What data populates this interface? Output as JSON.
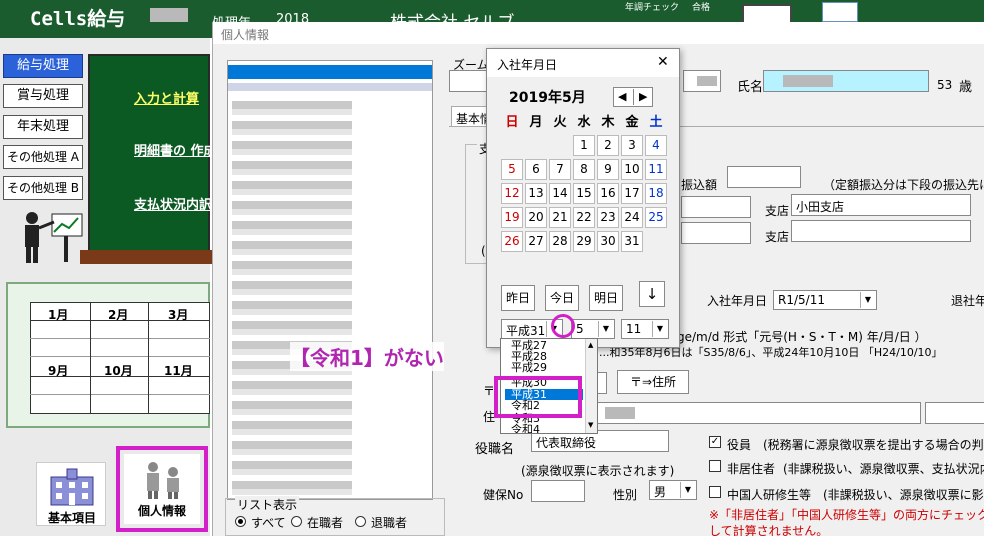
{
  "app": {
    "title": "Cells給与",
    "header_label": "処理年",
    "header_year": "2018",
    "company": "株式会社 セルブ",
    "top_right_1": "年調チェック",
    "top_right_2": "合格"
  },
  "left_menu": {
    "items": [
      "給与処理",
      "賞与処理",
      "年末処理",
      "その他処理 A",
      "その他処理 B"
    ]
  },
  "board": {
    "links": [
      "入力と計算",
      "明細書の 作成",
      "支払状況内訳"
    ]
  },
  "months": {
    "row1": [
      "1月",
      "2月",
      "3月"
    ],
    "row2": [
      "9月",
      "10月",
      "11月"
    ]
  },
  "bottom_icons": {
    "basic": "基本項目",
    "personal": "個人情報"
  },
  "window": {
    "title": "個人情報",
    "zoom_label": "ズーム",
    "tab_basic": "基本情",
    "name_label": "氏名",
    "age": "53",
    "age_unit": "歳",
    "fixed_amount_label": "振込額",
    "fixed_note": "（定額振込分は下段の振込先に",
    "branch_label": "支店",
    "branch_value": "小田支店",
    "branch_label2": "支店",
    "hire_date_label": "入社年月日",
    "hire_date_value": "R1/5/11",
    "retire_label": "退社年",
    "format_note": "ge/m/d  形式「元号(H・S・T・M)  年/月/日 ）",
    "example_note": "...和35年8月6日は「S35/8/6」、平成24年10月10日 「H24/10/10」",
    "zip_to_address": "〒⇒住所",
    "zip_label": "〒",
    "address_label": "住",
    "role_label": "役職名",
    "role_value": "代表取締役",
    "role_note": "(源泉徴収票に表示されます)",
    "officer_label": "役員",
    "officer_note": "(税務署に源泉徴収票を提出する場合の判定に",
    "nonresident_label": "非居住者",
    "nonresident_note": "(非課税扱い、源泉徴収票、支払状況内",
    "trainee_label": "中国人研修生等",
    "trainee_note": "(非課税扱い、源泉徴収票に影響",
    "insurance_label": "健保No",
    "gender_label": "性別",
    "gender_value": "男",
    "warning_1": "※「非居住者」「中国人研修生等」の両方にチェックをいれ",
    "warning_2": "して計算されません。",
    "list_display_label": "リスト表示",
    "radio_all": "すべて",
    "radio_employed": "在職者",
    "radio_retired": "退職者"
  },
  "date_picker": {
    "title": "入社年月日",
    "close": "✕",
    "month_label": "2019年5月",
    "weekdays": [
      "日",
      "月",
      "火",
      "水",
      "木",
      "金",
      "土"
    ],
    "days": [
      "1",
      "2",
      "3",
      "4",
      "5",
      "6",
      "7",
      "8",
      "9",
      "10",
      "11",
      "12",
      "13",
      "14",
      "15",
      "16",
      "17",
      "18",
      "19",
      "20",
      "21",
      "22",
      "23",
      "24",
      "25",
      "26",
      "27",
      "28",
      "29",
      "30",
      "31"
    ],
    "yesterday": "昨日",
    "today": "今日",
    "tomorrow": "明日",
    "down": "↓",
    "era_value": "平成31",
    "month_value": "5",
    "day_value": "11",
    "era_options": [
      "平成27",
      "平成28",
      "平成29",
      "平成30",
      "平成31",
      "令和2",
      "令和3",
      "令和4"
    ],
    "selected_option": "平成31"
  },
  "annotation": {
    "text": "【令和1】がない"
  },
  "colors": {
    "green_bar": "#1a5c2e",
    "board": "#0c5a23",
    "highlight": "#d21fc8",
    "selected": "#0078d7",
    "sunday": "#cc0000",
    "saturday": "#0033cc"
  }
}
